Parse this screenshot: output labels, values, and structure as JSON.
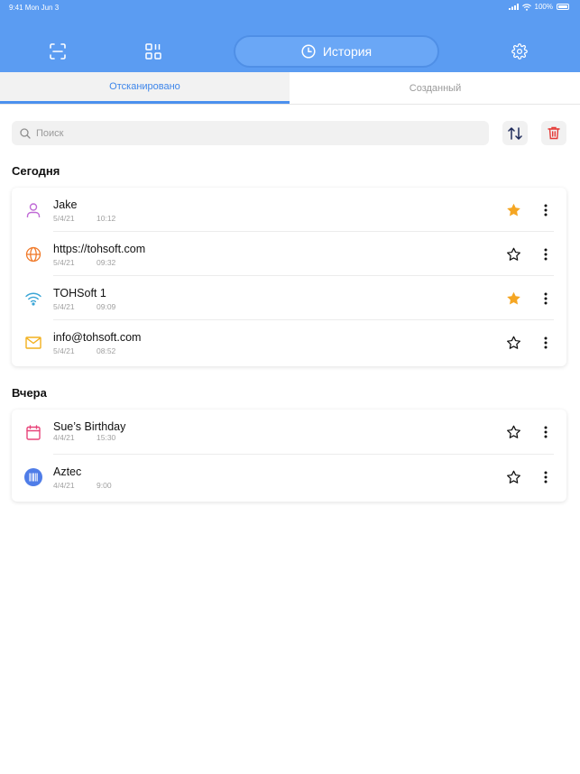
{
  "status_bar": {
    "time": "9:41  Mon Jun 3",
    "battery": "100%"
  },
  "toolbar": {
    "scan_icon": "scan-icon",
    "qr_icon": "qr-grid-icon",
    "history_label": "История",
    "settings_icon": "gear-icon"
  },
  "tabs": [
    {
      "label": "Отсканировано",
      "active": true
    },
    {
      "label": "Созданный",
      "active": false
    }
  ],
  "search": {
    "placeholder": "Поиск"
  },
  "sections": [
    {
      "title": "Сегодня",
      "items": [
        {
          "icon": "contact-icon",
          "title": "Jake",
          "date": "5/4/21",
          "time": "10:12",
          "favorite": true
        },
        {
          "icon": "globe-icon",
          "title": "https://tohsoft.com",
          "date": "5/4/21",
          "time": "09:32",
          "favorite": false
        },
        {
          "icon": "wifi-icon",
          "title": "TOHSoft 1",
          "date": "5/4/21",
          "time": "09:09",
          "favorite": true
        },
        {
          "icon": "email-icon",
          "title": "info@tohsoft.com",
          "date": "5/4/21",
          "time": "08:52",
          "favorite": false
        }
      ]
    },
    {
      "title": "Вчера",
      "items": [
        {
          "icon": "calendar-icon",
          "title": "Sue’s Birthday",
          "date": "4/4/21",
          "time": "15:30",
          "favorite": false
        },
        {
          "icon": "barcode-icon",
          "title": "Aztec",
          "date": "4/4/21",
          "time": "9:00",
          "favorite": false
        }
      ]
    }
  ],
  "colors": {
    "header": "#5b9cf2",
    "accent": "#4b90ee",
    "star_filled": "#f5a623",
    "delete": "#e53935"
  }
}
